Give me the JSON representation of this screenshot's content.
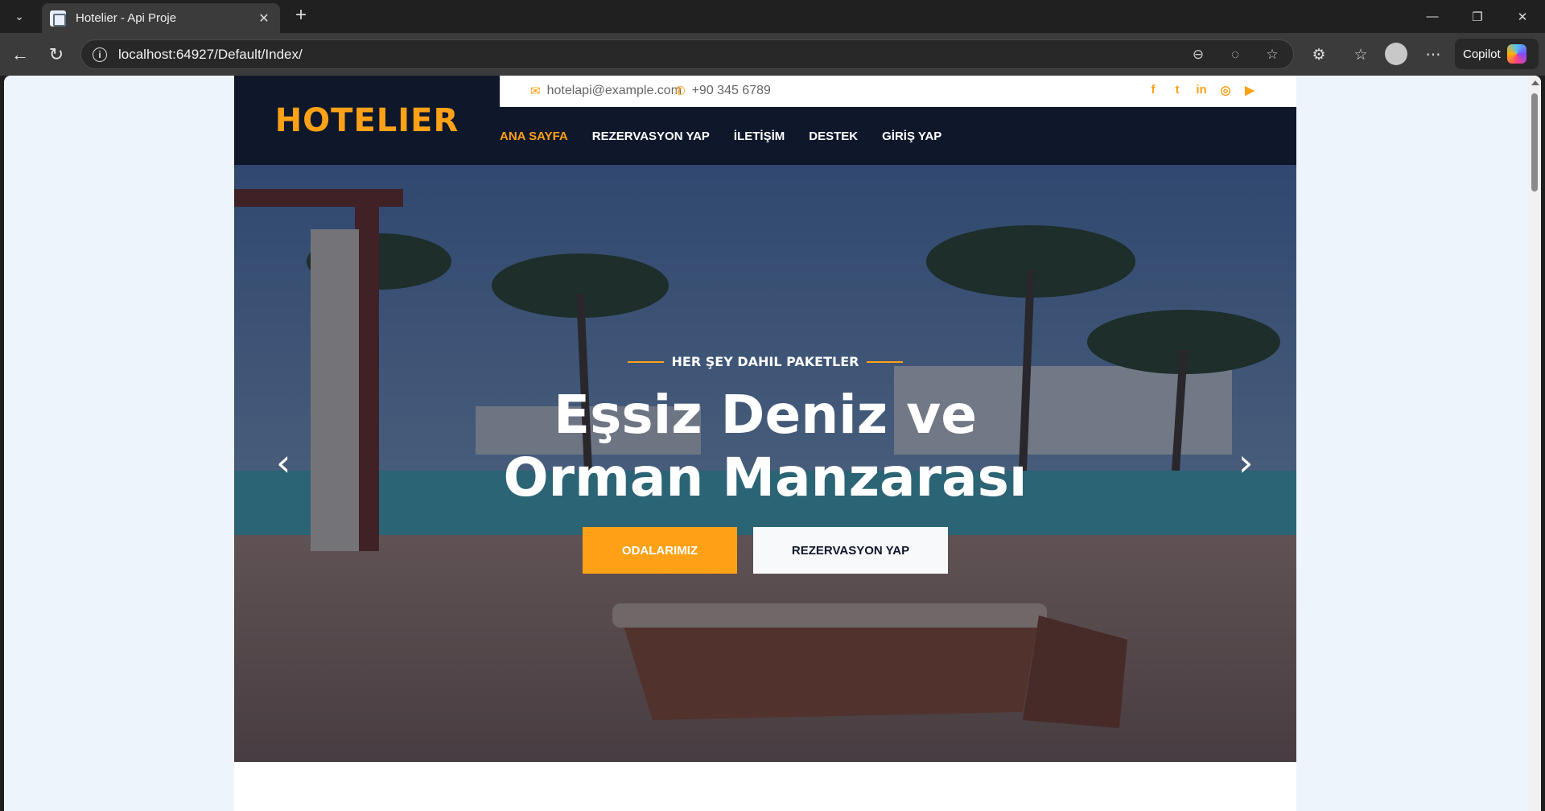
{
  "browser": {
    "tab_title": "Hotelier - Api Proje",
    "url": "localhost:64927/Default/Index/",
    "copilot_label": "Copilot"
  },
  "site": {
    "brand": "HOTELIER",
    "topbar": {
      "email": "hotelapi@example.com",
      "phone": "+90 345 6789"
    },
    "nav": [
      "ANA SAYFA",
      "REZERVASYON YAP",
      "İLETİŞİM",
      "DESTEK",
      "GİRİŞ YAP"
    ],
    "hero": {
      "eyebrow": "HER ŞEY DAHIL PAKETLER",
      "headline_line1": "Eşsiz Deniz ve",
      "headline_line2": "Orman Manzarası",
      "primary_button": "ODALARIMIZ",
      "secondary_button": "REZERVASYON YAP"
    }
  },
  "colors": {
    "accent": "#FEA116",
    "dark": "#0F172B"
  }
}
